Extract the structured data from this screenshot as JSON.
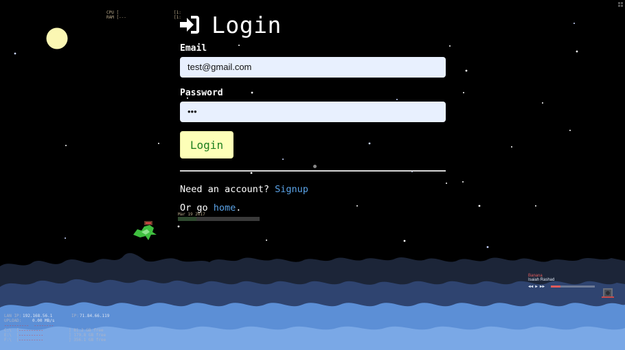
{
  "login": {
    "title": "Login",
    "email_label": "Email",
    "email_value": "test@gmail.com",
    "password_label": "Password",
    "password_value": "•••",
    "submit_label": "Login",
    "signup_prompt": "Need an account? ",
    "signup_link": "Signup",
    "home_prompt": "Or go ",
    "home_link": "home",
    "home_suffix": "."
  },
  "hud": {
    "cpu_label": "CPU [",
    "ram_label": "RAM [---",
    "bracket_a": "[1:",
    "bracket_b": "[1:",
    "date_text": "Mar  19 2017",
    "date_progress": 0.23,
    "lan_ip_label": "LAN IP:",
    "lan_ip": "192.168.56.1",
    "ip_label": "IP:",
    "ip": "71.84.66.119",
    "upload_label": "UPLOAD:",
    "upload_value": "0.00 MB/s",
    "red_line": "----------  --------",
    "drive_c_label": "C:\\  [",
    "drive_c_bar": "----------",
    "drive_c_free": "] 81.2 GB free",
    "drive_e_label": "E:\\  [",
    "drive_e_bar": "----------",
    "drive_e_free": "] 179.8 GB free",
    "drive_f_label": "F:\\  [",
    "drive_f_bar": "----------",
    "drive_f_free": "] 356.1 GB free"
  },
  "player": {
    "song": "Banana",
    "artist": "Isaiah Rashad",
    "progress": 0.22
  },
  "colors": {
    "sky": "#000000",
    "accent_link": "#5aa2e6",
    "button_bg": "#fdffb8",
    "button_text": "#1e7f1e",
    "cloud_dark": "#1c2538",
    "cloud_mid": "#2f4470",
    "cloud_light": "#5c8fd6"
  },
  "icons": {
    "login": "sign-in-icon",
    "dragon": "dragon-sprite",
    "moon": "moon",
    "speaker": "speaker-icon"
  }
}
